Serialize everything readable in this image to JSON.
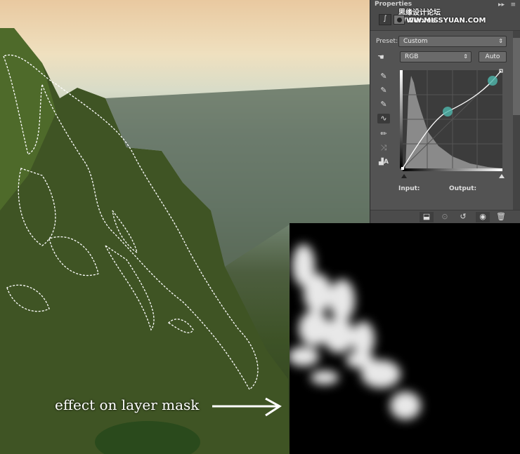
{
  "panel": {
    "title": "Properties",
    "watermark": "思缘设计论坛 WWW.MISSYUAN.COM",
    "adjustment": "Curves",
    "preset_label": "Preset:",
    "preset_value": "Custom",
    "channel_value": "RGB",
    "auto_label": "Auto",
    "input_label": "Input:",
    "output_label": "Output:",
    "tools": [
      "sample-black-eyedropper-icon",
      "sample-gray-eyedropper-icon",
      "sample-white-eyedropper-icon",
      "curve-edit-points-icon",
      "pencil-draw-icon",
      "smooth-curve-icon",
      "clipping-warning-icon"
    ],
    "footer_buttons": [
      "clip-to-layer-icon",
      "view-previous-state-icon",
      "reset-icon",
      "visibility-eye-icon",
      "trash-icon"
    ],
    "accent_color": "#4fb8ad"
  },
  "annotation": {
    "caption": "effect on layer mask"
  }
}
